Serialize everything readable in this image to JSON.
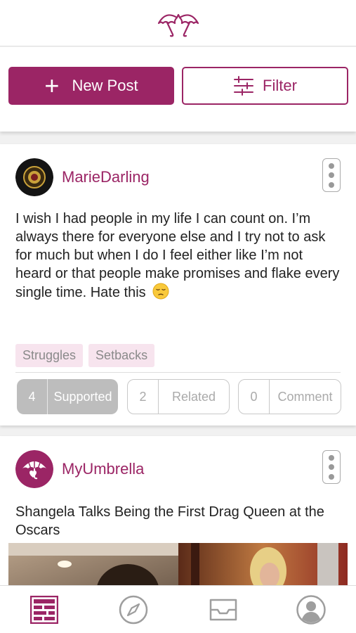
{
  "app": {
    "brand_color": "#9b2565",
    "logo_icon": "umbrellas-logo-icon"
  },
  "toolbar": {
    "new_post_label": "New Post",
    "new_post_icon": "plus-icon",
    "filter_label": "Filter",
    "filter_icon": "sliders-icon"
  },
  "feed": {
    "posts": [
      {
        "username": "MarieDarling",
        "avatar": "round-badge-avatar",
        "text": "I wish I had people in my life I can count on. I’m always there for everyone else and I try not to ask for much but when I do I feel either like I’m not heard or that people make promises and flake every single time. Hate this",
        "emoji": "pensive-face-emoji",
        "tags": [
          "Struggles",
          "Setbacks"
        ],
        "stats": {
          "supported": {
            "count": "4",
            "label": "Supported",
            "active": true
          },
          "related": {
            "count": "2",
            "label": "Related"
          },
          "comment": {
            "count": "0",
            "label": "Comment"
          }
        }
      },
      {
        "username": "MyUmbrella",
        "avatar": "umbrella-logo-avatar",
        "headline": "Shangela Talks Being the First Drag Queen at the Oscars",
        "image": "video-thumbnail"
      }
    ]
  },
  "tabbar": {
    "items": [
      {
        "icon": "feed-grid-icon",
        "active": true
      },
      {
        "icon": "compass-icon"
      },
      {
        "icon": "inbox-tray-icon"
      },
      {
        "icon": "profile-silhouette-icon"
      }
    ]
  }
}
